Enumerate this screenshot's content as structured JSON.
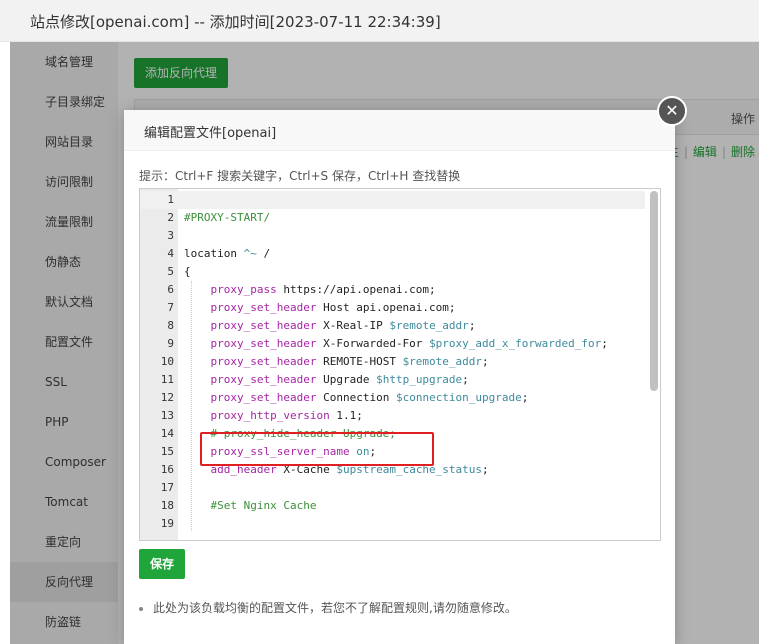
{
  "window": {
    "title": "站点修改[openai.com] -- 添加时间[2023-07-11 22:34:39]"
  },
  "sidebar": {
    "items": [
      {
        "label": "域名管理",
        "active": false
      },
      {
        "label": "子目录绑定",
        "active": false
      },
      {
        "label": "网站目录",
        "active": false
      },
      {
        "label": "访问限制",
        "active": false
      },
      {
        "label": "流量限制",
        "active": false
      },
      {
        "label": "伪静态",
        "active": false
      },
      {
        "label": "默认文档",
        "active": false
      },
      {
        "label": "配置文件",
        "active": false
      },
      {
        "label": "SSL",
        "active": false
      },
      {
        "label": "PHP",
        "active": false
      },
      {
        "label": "Composer",
        "active": false
      },
      {
        "label": "Tomcat",
        "active": false
      },
      {
        "label": "重定向",
        "active": false
      },
      {
        "label": "反向代理",
        "active": true
      },
      {
        "label": "防盗链",
        "active": false
      }
    ]
  },
  "main": {
    "add_proxy_label": "添加反向代理",
    "table_header_op": "操作",
    "row_actions": [
      "生",
      "编辑",
      "删除"
    ]
  },
  "modal": {
    "title": "编辑配置文件[openai]",
    "tip": "提示：Ctrl+F 搜索关键字，Ctrl+S 保存，Ctrl+H 查找替换",
    "save_label": "保存",
    "note": "此处为该负载均衡的配置文件，若您不了解配置规则,请勿随意修改。",
    "close_glyph": "✕"
  },
  "editor": {
    "current_line": 1,
    "highlighted_line": 15,
    "lines": [
      {
        "n": "1",
        "parts": [
          {
            "t": ""
          }
        ]
      },
      {
        "n": "2",
        "parts": [
          {
            "t": "#PROXY-START/",
            "c": 3
          }
        ]
      },
      {
        "n": "3",
        "parts": [
          {
            "t": ""
          }
        ]
      },
      {
        "n": "4",
        "parts": [
          {
            "t": "location ",
            "c": 0
          },
          {
            "t": "^~",
            "c": 2
          },
          {
            "t": " /",
            "c": 0
          }
        ]
      },
      {
        "n": "5",
        "parts": [
          {
            "t": "{",
            "c": 0
          }
        ]
      },
      {
        "n": "6",
        "parts": [
          {
            "t": "    ",
            "c": 0
          },
          {
            "t": "proxy_pass",
            "c": 1
          },
          {
            "t": " https://api.openai.com;",
            "c": 0
          }
        ]
      },
      {
        "n": "7",
        "parts": [
          {
            "t": "    ",
            "c": 0
          },
          {
            "t": "proxy_set_header",
            "c": 1
          },
          {
            "t": " Host api.openai.com;",
            "c": 0
          }
        ]
      },
      {
        "n": "8",
        "parts": [
          {
            "t": "    ",
            "c": 0
          },
          {
            "t": "proxy_set_header",
            "c": 1
          },
          {
            "t": " X-Real-IP ",
            "c": 0
          },
          {
            "t": "$remote_addr",
            "c": 2
          },
          {
            "t": ";",
            "c": 0
          }
        ]
      },
      {
        "n": "9",
        "parts": [
          {
            "t": "    ",
            "c": 0
          },
          {
            "t": "proxy_set_header",
            "c": 1
          },
          {
            "t": " X-Forwarded-For ",
            "c": 0
          },
          {
            "t": "$proxy_add_x_forwarded_for",
            "c": 2
          },
          {
            "t": ";",
            "c": 0
          }
        ]
      },
      {
        "n": "10",
        "parts": [
          {
            "t": "    ",
            "c": 0
          },
          {
            "t": "proxy_set_header",
            "c": 1
          },
          {
            "t": " REMOTE-HOST ",
            "c": 0
          },
          {
            "t": "$remote_addr",
            "c": 2
          },
          {
            "t": ";",
            "c": 0
          }
        ]
      },
      {
        "n": "11",
        "parts": [
          {
            "t": "    ",
            "c": 0
          },
          {
            "t": "proxy_set_header",
            "c": 1
          },
          {
            "t": " Upgrade ",
            "c": 0
          },
          {
            "t": "$http_upgrade",
            "c": 2
          },
          {
            "t": ";",
            "c": 0
          }
        ]
      },
      {
        "n": "12",
        "parts": [
          {
            "t": "    ",
            "c": 0
          },
          {
            "t": "proxy_set_header",
            "c": 1
          },
          {
            "t": " Connection ",
            "c": 0
          },
          {
            "t": "$connection_upgrade",
            "c": 2
          },
          {
            "t": ";",
            "c": 0
          }
        ]
      },
      {
        "n": "13",
        "parts": [
          {
            "t": "    ",
            "c": 0
          },
          {
            "t": "proxy_http_version",
            "c": 1
          },
          {
            "t": " 1.1;",
            "c": 0
          }
        ]
      },
      {
        "n": "14",
        "parts": [
          {
            "t": "    ",
            "c": 0
          },
          {
            "t": "# proxy_hide_header Upgrade;",
            "c": 3
          }
        ]
      },
      {
        "n": "15",
        "parts": [
          {
            "t": "    ",
            "c": 0
          },
          {
            "t": "proxy_ssl_server_name",
            "c": 1
          },
          {
            "t": " ",
            "c": 0
          },
          {
            "t": "on",
            "c": 2
          },
          {
            "t": ";",
            "c": 0
          }
        ]
      },
      {
        "n": "16",
        "parts": [
          {
            "t": "    ",
            "c": 0
          },
          {
            "t": "add_header",
            "c": 1
          },
          {
            "t": " X-Cache ",
            "c": 0
          },
          {
            "t": "$upstream_cache_status",
            "c": 2
          },
          {
            "t": ";",
            "c": 0
          }
        ]
      },
      {
        "n": "17",
        "parts": [
          {
            "t": ""
          }
        ]
      },
      {
        "n": "18",
        "parts": [
          {
            "t": "    ",
            "c": 0
          },
          {
            "t": "#Set Nginx Cache",
            "c": 3
          }
        ]
      },
      {
        "n": "19",
        "parts": [
          {
            "t": ""
          }
        ]
      }
    ]
  },
  "colors": {
    "accent": "#20a53a",
    "highlight_box": "#e02020"
  }
}
